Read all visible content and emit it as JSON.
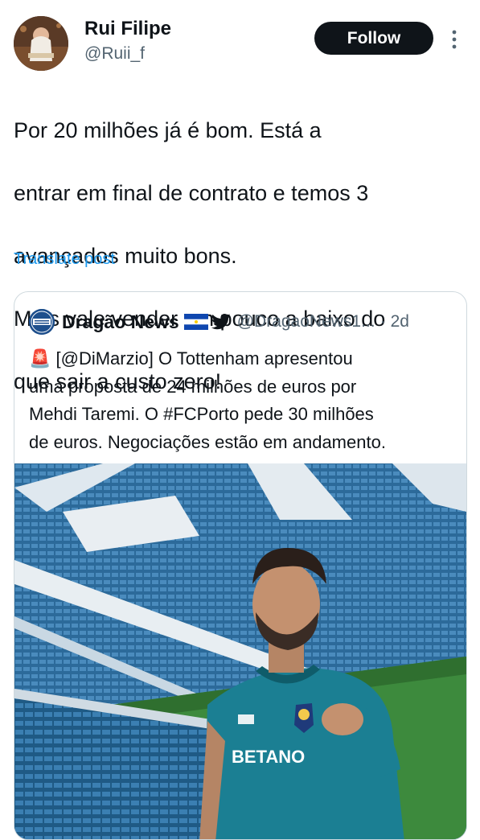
{
  "author": {
    "name": "Rui Filipe",
    "handle": "@Ruii_f",
    "follow_label": "Follow"
  },
  "post": {
    "text_lines": [
      "Por 20 milhões já é bom. Está a",
      "entrar em final de contrato e temos 3",
      "avançados muito bons.",
      "Mais vale vender um pouco a baixo do",
      "que sair a custo zero!"
    ],
    "translate_label": "Translate post"
  },
  "quote": {
    "name": "Dragão News",
    "handle": "@DragaoNews1...",
    "separator": "·",
    "time": "2d",
    "logo_text": "DRAGÃO NEWS",
    "text_lines": [
      "🚨 [@DiMarzio] O Tottenham apresentou",
      "uma proposta de 24 milhões de euros por",
      "Mehdi Taremi. O #FCPorto pede 30 milhões",
      "de euros. Negociações estão em andamento."
    ],
    "media": {
      "jersey_text": "BETANO",
      "icons": [
        "flag-icon",
        "bird-icon",
        "rotating-light-icon"
      ]
    }
  },
  "colors": {
    "primary_text": "#0f1419",
    "secondary_text": "#536471",
    "link": "#1d9bf0",
    "follow_bg": "#0f1419",
    "border": "#cfd9de",
    "jersey": "#1b7f93"
  }
}
